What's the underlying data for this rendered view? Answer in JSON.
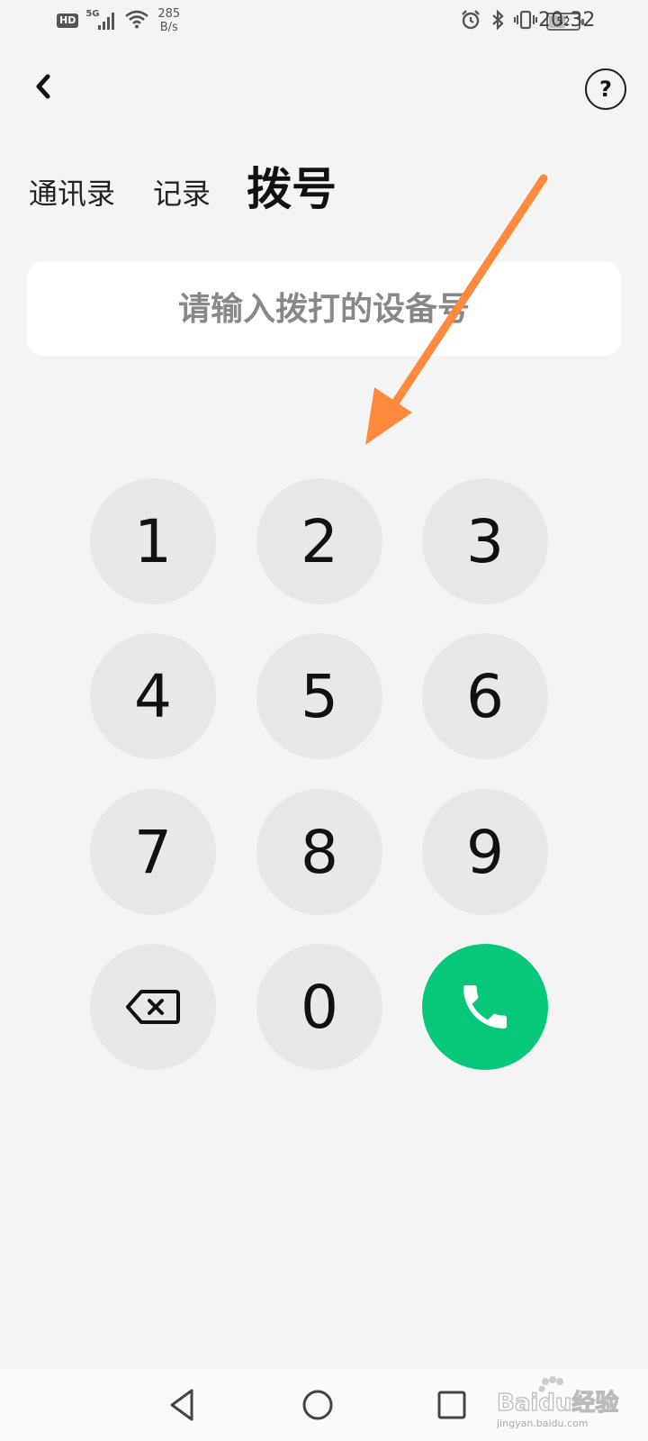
{
  "status_bar": {
    "hd": "HD",
    "network": "5G",
    "speed_value": "285",
    "speed_unit": "B/s",
    "battery": "52",
    "battery_level": 0.52,
    "time": "20:32"
  },
  "tabs": [
    {
      "label": "通讯录",
      "active": false
    },
    {
      "label": "记录",
      "active": false
    },
    {
      "label": "拨号",
      "active": true
    }
  ],
  "input": {
    "placeholder": "请输入拨打的设备号",
    "value": ""
  },
  "keypad": {
    "keys": [
      "1",
      "2",
      "3",
      "4",
      "5",
      "6",
      "7",
      "8",
      "9",
      "0"
    ]
  },
  "colors": {
    "call": "#07c77a",
    "arrow": "#ff8a3d",
    "key_bg": "#e8e8e8",
    "page_bg": "#f4f4f4"
  },
  "icons": {
    "back": "chevron-left-icon",
    "help": "question-mark-icon",
    "backspace": "backspace-icon",
    "call": "phone-icon",
    "nav_back": "triangle-back-icon",
    "nav_home": "circle-home-icon",
    "nav_recent": "square-recent-icon"
  },
  "help_label": "?",
  "watermark": {
    "brand": "Baidu经验",
    "url": "jingyan.baidu.com"
  }
}
